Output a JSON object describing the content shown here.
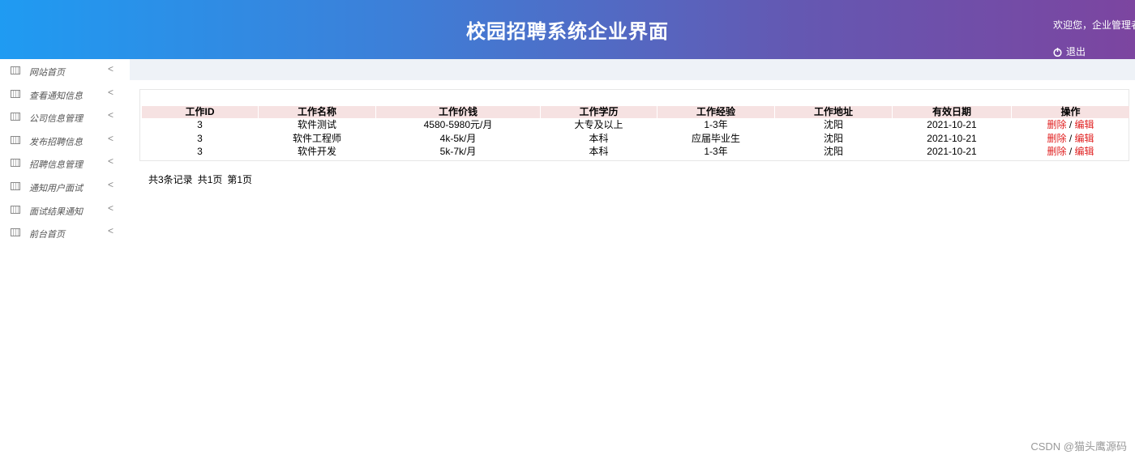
{
  "header": {
    "title": "校园招聘系统企业界面",
    "welcome": "欢迎您，企业管理者",
    "logout": "退出"
  },
  "sidebar": {
    "items": [
      {
        "label": "网站首页"
      },
      {
        "label": "查看通知信息"
      },
      {
        "label": "公司信息管理"
      },
      {
        "label": "发布招聘信息"
      },
      {
        "label": "招聘信息管理"
      },
      {
        "label": "通知用户面试"
      },
      {
        "label": "面试结果通知"
      },
      {
        "label": "前台首页"
      }
    ]
  },
  "table": {
    "headers": [
      "工作ID",
      "工作名称",
      "工作价钱",
      "工作学历",
      "工作经验",
      "工作地址",
      "有效日期",
      "操作"
    ],
    "rows": [
      {
        "id": "3",
        "name": "软件测试",
        "price": "4580-5980元/月",
        "edu": "大专及以上",
        "exp": "1-3年",
        "addr": "沈阳",
        "date": "2021-10-21"
      },
      {
        "id": "3",
        "name": "软件工程师",
        "price": "4k-5k/月",
        "edu": "本科",
        "exp": "应届毕业生",
        "addr": "沈阳",
        "date": "2021-10-21"
      },
      {
        "id": "3",
        "name": "软件开发",
        "price": "5k-7k/月",
        "edu": "本科",
        "exp": "1-3年",
        "addr": "沈阳",
        "date": "2021-10-21"
      }
    ],
    "delete_label": "删除",
    "edit_label": "编辑",
    "sep": " / "
  },
  "pager": {
    "total": "共3条记录",
    "pages": "共1页",
    "current": "第1页"
  },
  "watermark": "CSDN @猫头鹰源码"
}
